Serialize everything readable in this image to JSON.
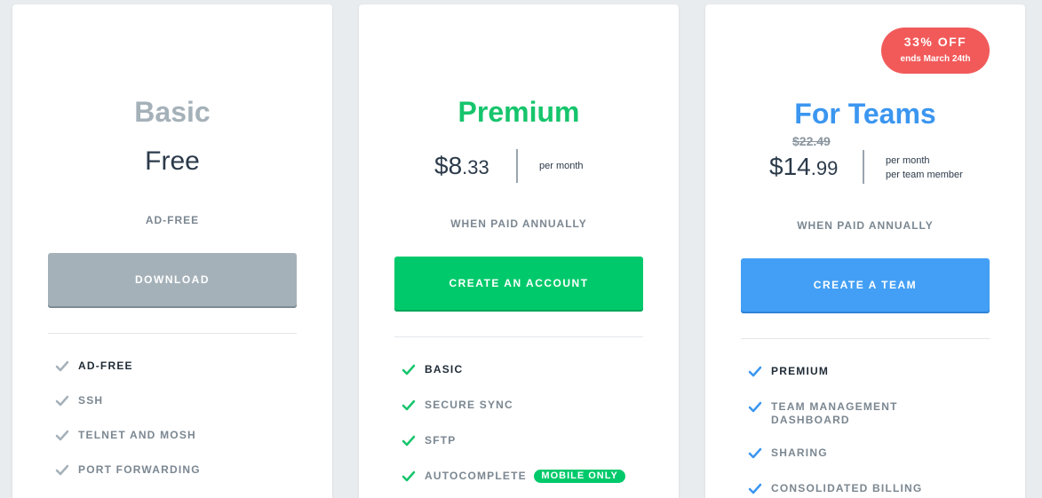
{
  "colors": {
    "page_bg": "#e8ecef",
    "basic_accent": "#a5b1b9",
    "premium_accent": "#00c96b",
    "teams_accent": "#439ff5",
    "discount_badge": "#f25a5a"
  },
  "basic": {
    "name": "Basic",
    "price_label": "Free",
    "billing_note": "AD-FREE",
    "cta_label": "DOWNLOAD",
    "features": [
      "AD-FREE",
      "SSH",
      "TELNET AND MOSH",
      "PORT FORWARDING"
    ],
    "check_icon": "check-icon"
  },
  "premium": {
    "name": "Premium",
    "price_dollars": "$8",
    "price_cents": ".33",
    "per_text": "per month",
    "billing_note": "WHEN PAID ANNUALLY",
    "cta_label": "CREATE AN ACCOUNT",
    "features": [
      "BASIC",
      "SECURE SYNC",
      "SFTP",
      "AUTOCOMPLETE"
    ],
    "mobile_only_badge": "MOBILE ONLY",
    "check_icon": "check-icon"
  },
  "teams": {
    "discount": {
      "title": "33% OFF",
      "subtitle": "ends March 24th"
    },
    "name": "For Teams",
    "old_price": "$22.49",
    "price_dollars": "$14",
    "price_cents": ".99",
    "per_text_line1": "per month",
    "per_text_line2": "per team member",
    "billing_note": "WHEN PAID ANNUALLY",
    "cta_label": "CREATE A TEAM",
    "features": [
      "PREMIUM",
      "TEAM MANAGEMENT",
      "DASHBOARD",
      "SHARING",
      "CONSOLIDATED BILLING"
    ],
    "check_icon": "check-icon"
  }
}
